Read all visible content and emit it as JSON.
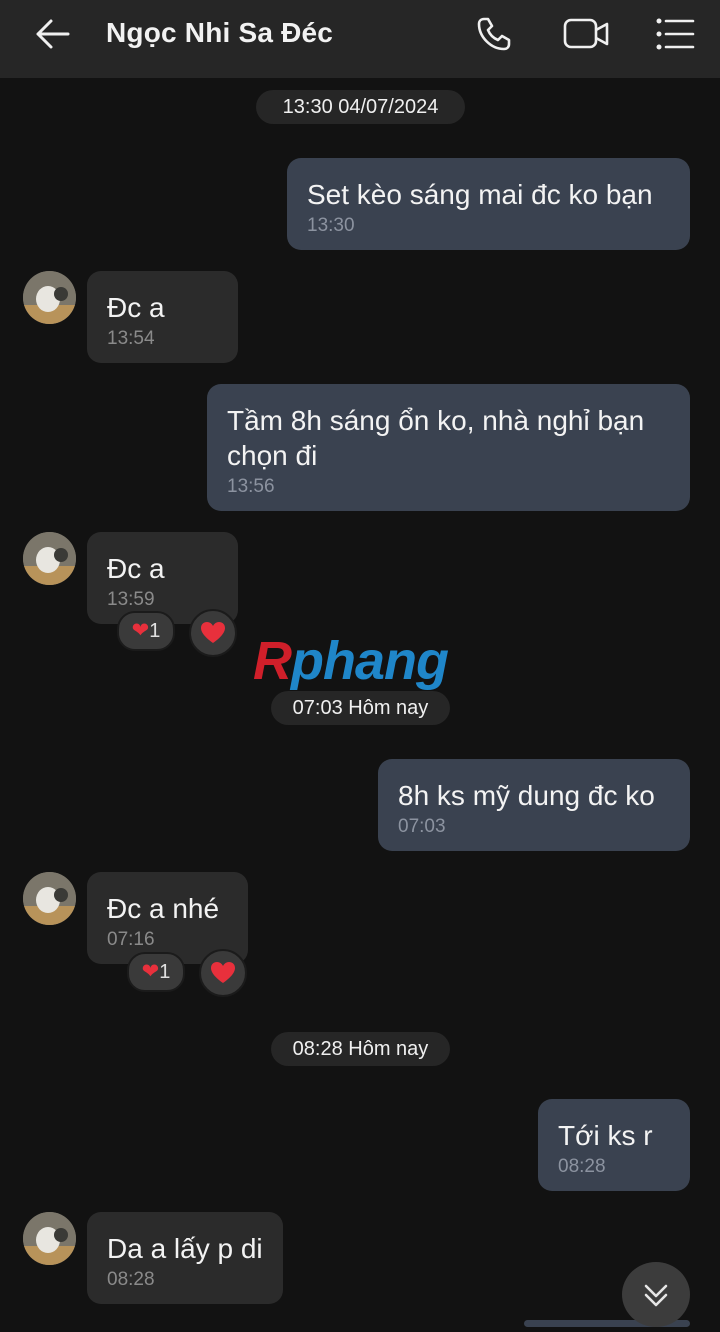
{
  "header": {
    "title": "Ngọc Nhi Sa Đéc",
    "back_icon": "arrow-left-icon",
    "call_icon": "phone-icon",
    "video_icon": "video-camera-icon",
    "menu_icon": "list-menu-icon"
  },
  "stamps": [
    "13:30 04/07/2024",
    "07:03 Hôm nay",
    "08:28 Hôm nay"
  ],
  "messages": [
    {
      "dir": "out",
      "text": "Set kèo sáng mai đc ko bạn",
      "time": "13:30"
    },
    {
      "dir": "in",
      "text": "Đc a",
      "time": "13:54"
    },
    {
      "dir": "out",
      "text_line1": "Tầm 8h sáng ổn ko, nhà nghỉ bạn",
      "text_line2": "chọn đi",
      "time": "13:56"
    },
    {
      "dir": "in",
      "text": "Đc a",
      "time": "13:59",
      "reaction_count": "1",
      "reaction_icon": "heart-icon"
    },
    {
      "dir": "out",
      "text": "8h ks mỹ dung đc ko",
      "time": "07:03"
    },
    {
      "dir": "in",
      "text": "Đc a nhé",
      "time": "07:16",
      "reaction_count": "1",
      "reaction_icon": "heart-icon"
    },
    {
      "dir": "out",
      "text": "Tới ks r",
      "time": "08:28"
    },
    {
      "dir": "in",
      "text": "Da a lấy p di",
      "time": "08:28"
    }
  ],
  "watermark": {
    "first": "R",
    "rest": "phang"
  },
  "colors": {
    "background": "#121212",
    "header": "#262626",
    "outgoing_bubble": "#3a4250",
    "incoming_bubble": "#2b2b2b",
    "heart": "#e8303c"
  },
  "scroll_icon": "double-chevron-down-icon"
}
